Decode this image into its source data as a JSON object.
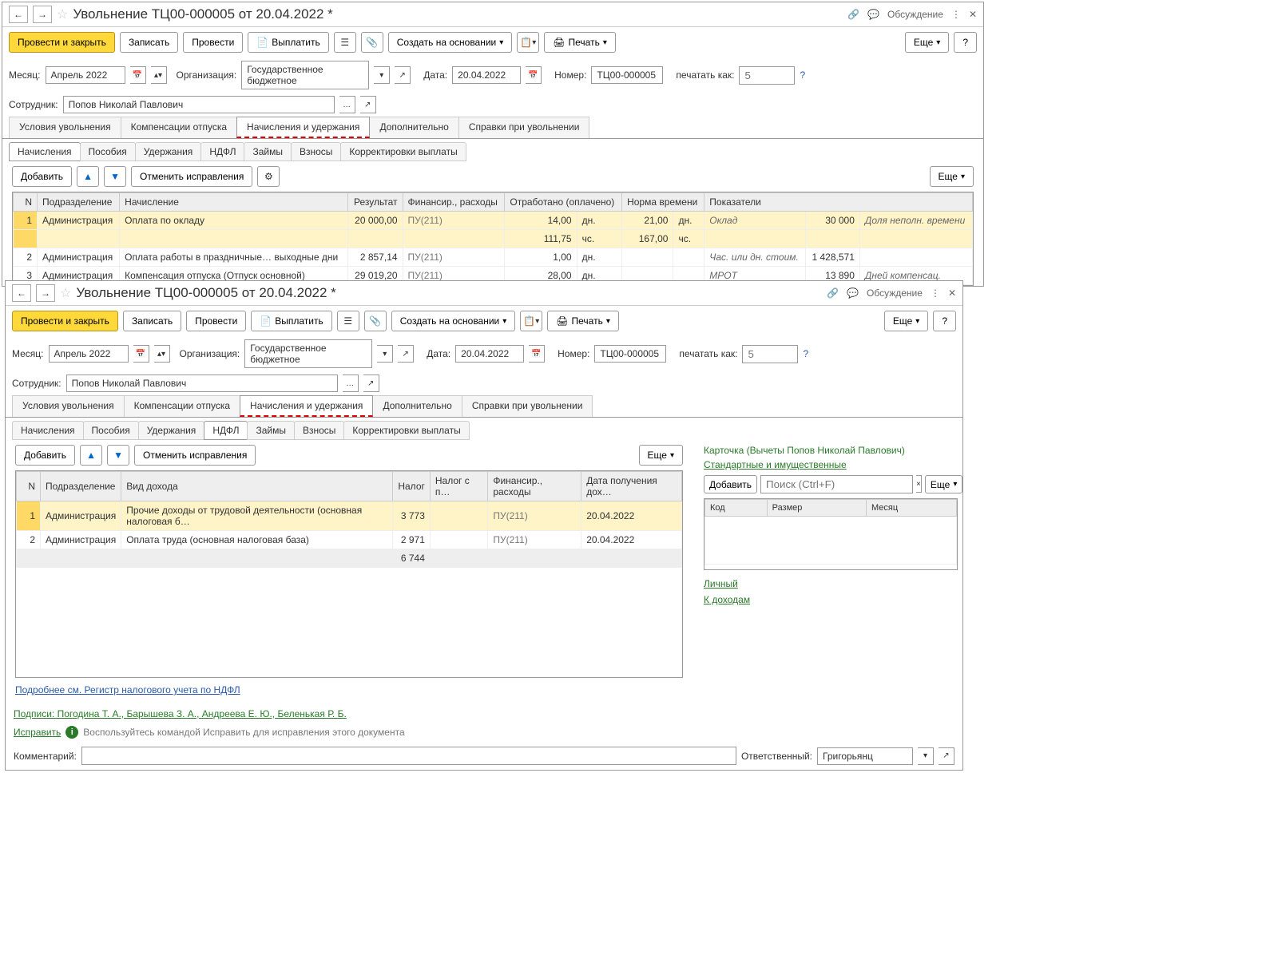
{
  "win1": {
    "title": "Увольнение ТЦ00-000005 от 20.04.2022 *",
    "discuss": "Обсуждение",
    "toolbar": {
      "post_close": "Провести и закрыть",
      "write": "Записать",
      "post": "Провести",
      "pay": "Выплатить",
      "create_based": "Создать на основании",
      "print": "Печать",
      "more": "Еще",
      "help": "?"
    },
    "form": {
      "month_lbl": "Месяц:",
      "month_val": "Апрель 2022",
      "org_lbl": "Организация:",
      "org_val": "Государственное бюджетное",
      "date_lbl": "Дата:",
      "date_val": "20.04.2022",
      "num_lbl": "Номер:",
      "num_val": "ТЦ00-000005",
      "print_as_lbl": "печатать как:",
      "print_as_ph": "5",
      "emp_lbl": "Сотрудник:",
      "emp_val": "Попов Николай Павлович"
    },
    "tabs": [
      "Условия увольнения",
      "Компенсации отпуска",
      "Начисления и удержания",
      "Дополнительно",
      "Справки при увольнении"
    ],
    "subtabs": [
      "Начисления",
      "Пособия",
      "Удержания",
      "НДФЛ",
      "Займы",
      "Взносы",
      "Корректировки выплаты"
    ],
    "tb2": {
      "add": "Добавить",
      "cancel": "Отменить исправления",
      "more": "Еще"
    },
    "cols": [
      "N",
      "Подразделение",
      "Начисление",
      "Результат",
      "Финансир., расходы",
      "Отработано (оплачено)",
      "",
      "Норма времени",
      "",
      "Показатели",
      "",
      ""
    ],
    "rows": [
      {
        "n": "1",
        "dept": "Администрация",
        "name": "Оплата по окладу",
        "res": "20 000,00",
        "fin": "ПУ(211)",
        "work": "14,00",
        "wu": "дн.",
        "norm": "21,00",
        "nu": "дн.",
        "ind": "Оклад",
        "indv": "30 000",
        "extra": "Доля неполн. времени"
      },
      {
        "n": "",
        "dept": "",
        "name": "",
        "res": "",
        "fin": "",
        "work": "111,75",
        "wu": "чс.",
        "norm": "167,00",
        "nu": "чс.",
        "ind": "",
        "indv": "",
        "extra": ""
      },
      {
        "n": "2",
        "dept": "Администрация",
        "name": "Оплата работы в праздничные… выходные дни",
        "res": "2 857,14",
        "fin": "ПУ(211)",
        "work": "1,00",
        "wu": "дн.",
        "norm": "",
        "nu": "",
        "ind": "Час. или дн. стоим.",
        "indv": "1 428,571",
        "extra": ""
      },
      {
        "n": "3",
        "dept": "Администрация",
        "name": "Компенсация отпуска (Отпуск основной)",
        "res": "29 019,20",
        "fin": "ПУ(211)",
        "work": "28,00",
        "wu": "дн.",
        "norm": "",
        "nu": "",
        "ind": "МРОТ",
        "indv": "13 890",
        "extra": "Дней компенсац."
      }
    ]
  },
  "win2": {
    "title": "Увольнение ТЦ00-000005 от 20.04.2022 *",
    "discuss": "Обсуждение",
    "toolbar": {
      "post_close": "Провести и закрыть",
      "write": "Записать",
      "post": "Провести",
      "pay": "Выплатить",
      "create_based": "Создать на основании",
      "print": "Печать",
      "more": "Еще",
      "help": "?"
    },
    "form": {
      "month_lbl": "Месяц:",
      "month_val": "Апрель 2022",
      "org_lbl": "Организация:",
      "org_val": "Государственное бюджетное",
      "date_lbl": "Дата:",
      "date_val": "20.04.2022",
      "num_lbl": "Номер:",
      "num_val": "ТЦ00-000005",
      "print_as_lbl": "печатать как:",
      "print_as_ph": "5",
      "emp_lbl": "Сотрудник:",
      "emp_val": "Попов Николай Павлович"
    },
    "tabs": [
      "Условия увольнения",
      "Компенсации отпуска",
      "Начисления и удержания",
      "Дополнительно",
      "Справки при увольнении"
    ],
    "subtabs": [
      "Начисления",
      "Пособия",
      "Удержания",
      "НДФЛ",
      "Займы",
      "Взносы",
      "Корректировки выплаты"
    ],
    "tb2": {
      "add": "Добавить",
      "cancel": "Отменить исправления",
      "more": "Еще"
    },
    "cols": [
      "N",
      "Подразделение",
      "Вид дохода",
      "Налог",
      "Налог с п…",
      "Финансир., расходы",
      "Дата получения дох…"
    ],
    "rows": [
      {
        "n": "1",
        "dept": "Администрация",
        "kind": "Прочие доходы от трудовой деятельности (основная налоговая б…",
        "tax": "3 773",
        "taxp": "",
        "fin": "ПУ(211)",
        "date": "20.04.2022"
      },
      {
        "n": "2",
        "dept": "Администрация",
        "kind": "Оплата труда (основная налоговая база)",
        "tax": "2 971",
        "taxp": "",
        "fin": "ПУ(211)",
        "date": "20.04.2022"
      }
    ],
    "total_tax": "6 744",
    "panel": {
      "title": "Карточка (Вычеты Попов Николай Павлович)",
      "std_link": "Стандартные и имущественные",
      "add": "Добавить",
      "search_ph": "Поиск (Ctrl+F)",
      "more": "Еще",
      "cols": [
        "Код",
        "Размер",
        "Месяц"
      ],
      "personal": "Личный",
      "to_income": "К доходам"
    },
    "reg_link": "Подробнее см. Регистр налогового учета по НДФЛ",
    "signers": "Подписи: Погодина Т. А., Барышева З. А., Андреева Е. Ю., Беленькая Р. Б.",
    "fix": "Исправить",
    "fix_hint": "Воспользуйтесь командой Исправить для исправления этого документа",
    "comment_lbl": "Комментарий:",
    "resp_lbl": "Ответственный:",
    "resp_val": "Григорьянц"
  }
}
